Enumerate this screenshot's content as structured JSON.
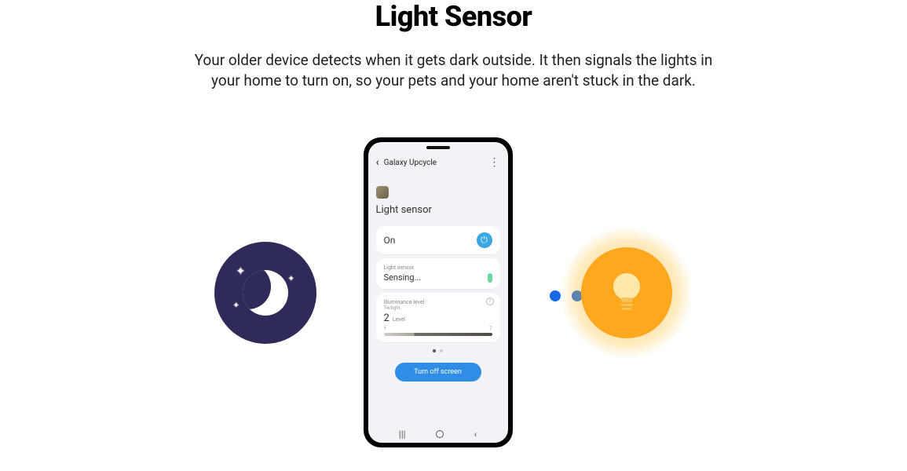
{
  "hero": {
    "title": "Light Sensor",
    "description": "Your older device detects when it gets dark outside. It then signals the lights in your home to turn on, so your pets and your home aren't stuck in the dark."
  },
  "phone": {
    "header": {
      "back_icon": "‹",
      "title": "Galaxy Upcycle",
      "more_icon": "⋮"
    },
    "feature_name": "Light sensor",
    "power": {
      "state_label": "On",
      "icon": "⏻"
    },
    "sensing": {
      "label": "Light sensor",
      "status": "Sensing..."
    },
    "illuminance": {
      "label": "Illuminance level",
      "sublabel": "Twilight",
      "value": "2",
      "unit": "Level",
      "scale_min": "1",
      "scale_max": "7",
      "info_icon": "?"
    },
    "turn_off_label": "Turn off screen",
    "nav": {
      "recent_icon": "|||",
      "back_icon": "‹"
    }
  }
}
